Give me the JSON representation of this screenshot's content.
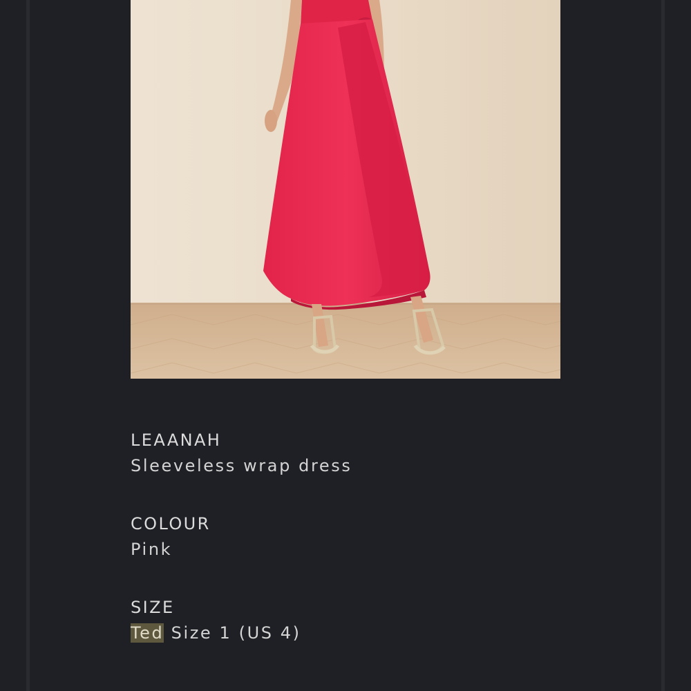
{
  "product": {
    "image_alt": "Model wearing pink sleeveless wrap dress with gold sandals",
    "dress_color": "#e8294f",
    "background_color": "#e9dcc9",
    "floor_color": "#d9bd9b"
  },
  "details": {
    "name_label": "LEAANAH",
    "name_value": "Sleeveless wrap dress",
    "colour_label": "COLOUR",
    "colour_value": "Pink",
    "size_label": "SIZE",
    "size_highlight": "Ted",
    "size_value": " Size 1 (US 4)"
  }
}
